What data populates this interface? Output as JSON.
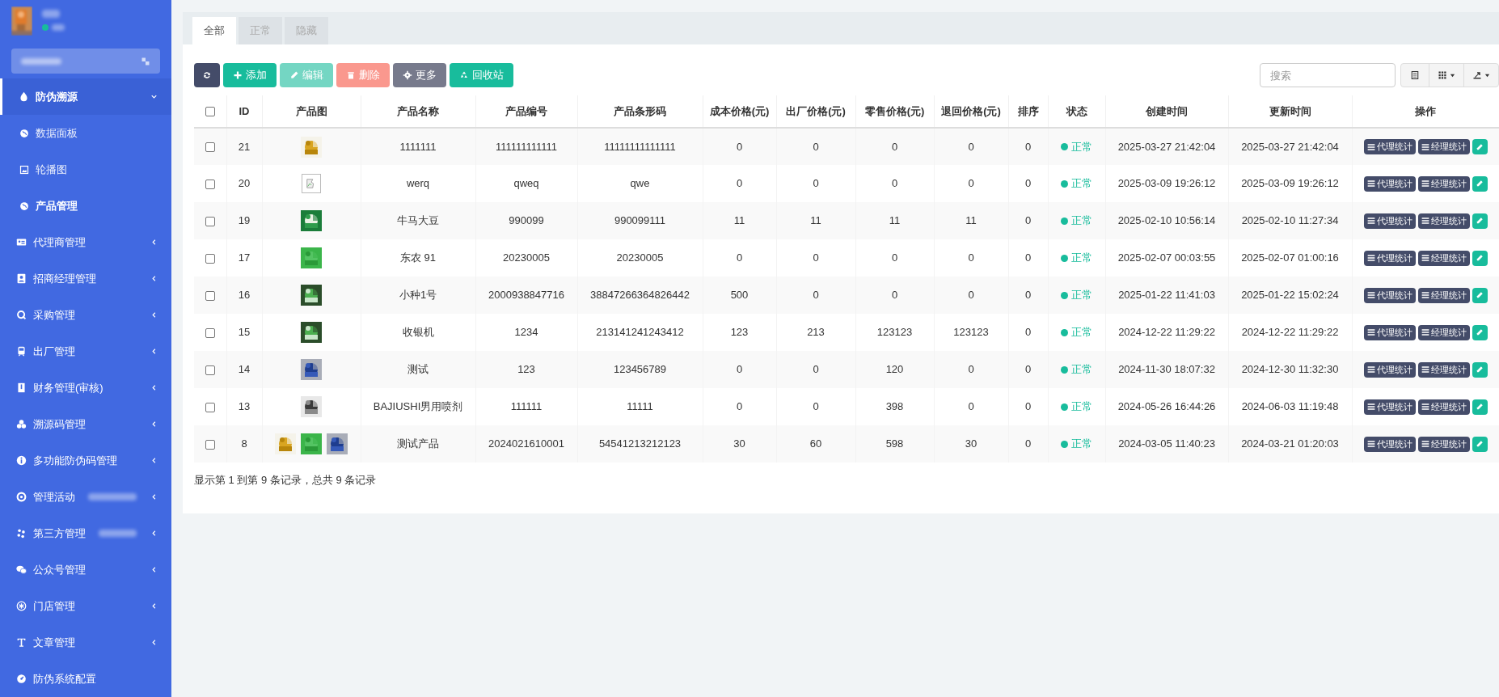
{
  "sidebar": {
    "avatar": {
      "kind": "picture"
    },
    "online": true,
    "menu": [
      {
        "kind": "group",
        "label": "防伪溯源",
        "expanded": true,
        "children": [
          {
            "label": "数据面板",
            "selected": false
          },
          {
            "label": "轮播图",
            "selected": false
          },
          {
            "label": "产品管理",
            "selected": true
          }
        ]
      },
      {
        "kind": "group",
        "label": "代理商管理",
        "expanded": false
      },
      {
        "kind": "group",
        "label": "招商经理管理",
        "expanded": false
      },
      {
        "kind": "group",
        "label": "采购管理",
        "expanded": false
      },
      {
        "kind": "group",
        "label": "出厂管理",
        "expanded": false
      },
      {
        "kind": "group",
        "label": "财务管理(审核)",
        "expanded": false
      },
      {
        "kind": "group",
        "label": "溯源码管理",
        "expanded": false
      },
      {
        "kind": "group",
        "label": "多功能防伪码管理",
        "expanded": false
      },
      {
        "kind": "group",
        "label": "管理活动",
        "expanded": false,
        "redacted_badge": true
      },
      {
        "kind": "group",
        "label": "第三方管理",
        "expanded": false,
        "redacted_badge": true
      },
      {
        "kind": "group",
        "label": "公众号管理",
        "expanded": false
      },
      {
        "kind": "group",
        "label": "门店管理",
        "expanded": false
      },
      {
        "kind": "group",
        "label": "文章管理",
        "expanded": false
      },
      {
        "kind": "link",
        "label": "防伪系统配置"
      }
    ]
  },
  "tabs": [
    {
      "label": "全部",
      "selected": true
    },
    {
      "label": "正常",
      "selected": false
    },
    {
      "label": "隐藏",
      "selected": false
    }
  ],
  "toolbar": [
    {
      "kind": "refresh",
      "disabled": false
    },
    {
      "kind": "add",
      "label": "添加",
      "disabled": false
    },
    {
      "kind": "edit",
      "label": "编辑",
      "disabled": true
    },
    {
      "kind": "delete",
      "label": "删除",
      "disabled": true
    },
    {
      "kind": "more",
      "label": "更多",
      "disabled": false
    },
    {
      "kind": "recycle",
      "label": "回收站",
      "disabled": false
    }
  ],
  "search": {
    "placeholder": "搜索"
  },
  "view_buttons": [
    {
      "kind": "toggle"
    },
    {
      "kind": "columns"
    },
    {
      "kind": "export"
    }
  ],
  "table": {
    "select_all": {
      "checked": false
    },
    "columns": [
      "ID",
      "产品图",
      "产品名称",
      "产品编号",
      "产品条形码",
      "成本价格(元)",
      "出厂价格(元)",
      "零售价格(元)",
      "退回价格(元)",
      "排序",
      "状态",
      "创建时间",
      "更新时间",
      "操作"
    ],
    "rows": [
      {
        "checked": false,
        "id": "21",
        "images": [
          {
            "kind": "picture"
          }
        ],
        "name": "1111111",
        "code": "111111111111",
        "barcode": "11111111111111",
        "cost": "0",
        "factory": "0",
        "retail": "0",
        "refund": "0",
        "sort": "0",
        "status": {
          "label": "正常",
          "color": "#18bc9c"
        },
        "created": "2025-03-27 21:42:04",
        "updated": "2025-03-27 21:42:04",
        "actions": [
          "代理统计",
          "经理统计"
        ]
      },
      {
        "checked": false,
        "id": "20",
        "images": [
          {
            "kind": "broken"
          }
        ],
        "name": "werq",
        "code": "qweq",
        "barcode": "qwe",
        "cost": "0",
        "factory": "0",
        "retail": "0",
        "refund": "0",
        "sort": "0",
        "status": {
          "label": "正常",
          "color": "#18bc9c"
        },
        "created": "2025-03-09 19:26:12",
        "updated": "2025-03-09 19:26:12",
        "actions": [
          "代理统计",
          "经理统计"
        ]
      },
      {
        "checked": false,
        "id": "19",
        "images": [
          {
            "kind": "picture"
          }
        ],
        "name": "牛马大豆",
        "code": "990099",
        "barcode": "990099111",
        "cost": "11",
        "factory": "11",
        "retail": "11",
        "refund": "11",
        "sort": "0",
        "status": {
          "label": "正常",
          "color": "#18bc9c"
        },
        "created": "2025-02-10 10:56:14",
        "updated": "2025-02-10 11:27:34",
        "actions": [
          "代理统计",
          "经理统计"
        ]
      },
      {
        "checked": false,
        "id": "17",
        "images": [
          {
            "kind": "picture"
          }
        ],
        "name": "东农 91",
        "code": "20230005",
        "barcode": "20230005",
        "cost": "0",
        "factory": "0",
        "retail": "0",
        "refund": "0",
        "sort": "0",
        "status": {
          "label": "正常",
          "color": "#18bc9c"
        },
        "created": "2025-02-07 00:03:55",
        "updated": "2025-02-07 01:00:16",
        "actions": [
          "代理统计",
          "经理统计"
        ]
      },
      {
        "checked": false,
        "id": "16",
        "images": [
          {
            "kind": "picture"
          }
        ],
        "name": "小种1号",
        "code": "2000938847716",
        "barcode": "38847266364826442",
        "cost": "500",
        "factory": "0",
        "retail": "0",
        "refund": "0",
        "sort": "0",
        "status": {
          "label": "正常",
          "color": "#18bc9c"
        },
        "created": "2025-01-22 11:41:03",
        "updated": "2025-01-22 15:02:24",
        "actions": [
          "代理统计",
          "经理统计"
        ]
      },
      {
        "checked": false,
        "id": "15",
        "images": [
          {
            "kind": "picture"
          }
        ],
        "name": "收银机",
        "code": "1234",
        "barcode": "213141241243412",
        "cost": "123",
        "factory": "213",
        "retail": "123123",
        "refund": "123123",
        "sort": "0",
        "status": {
          "label": "正常",
          "color": "#18bc9c"
        },
        "created": "2024-12-22 11:29:22",
        "updated": "2024-12-22 11:29:22",
        "actions": [
          "代理统计",
          "经理统计"
        ]
      },
      {
        "checked": false,
        "id": "14",
        "images": [
          {
            "kind": "picture"
          }
        ],
        "name": "测试",
        "code": "123",
        "barcode": "123456789",
        "cost": "0",
        "factory": "0",
        "retail": "120",
        "refund": "0",
        "sort": "0",
        "status": {
          "label": "正常",
          "color": "#18bc9c"
        },
        "created": "2024-11-30 18:07:32",
        "updated": "2024-12-30 11:32:30",
        "actions": [
          "代理统计",
          "经理统计"
        ]
      },
      {
        "checked": false,
        "id": "13",
        "images": [
          {
            "kind": "picture"
          }
        ],
        "name": "BAJIUSHI男用喷剂",
        "code": "111111",
        "barcode": "11111",
        "cost": "0",
        "factory": "0",
        "retail": "398",
        "refund": "0",
        "sort": "0",
        "status": {
          "label": "正常",
          "color": "#18bc9c"
        },
        "created": "2024-05-26 16:44:26",
        "updated": "2024-06-03 11:19:48",
        "actions": [
          "代理统计",
          "经理统计"
        ]
      },
      {
        "checked": false,
        "id": "8",
        "images": [
          {
            "kind": "picture"
          },
          {
            "kind": "picture"
          },
          {
            "kind": "picture"
          }
        ],
        "name": "测试产品",
        "code": "2024021610001",
        "barcode": "54541213212123",
        "cost": "30",
        "factory": "60",
        "retail": "598",
        "refund": "30",
        "sort": "0",
        "status": {
          "label": "正常",
          "color": "#18bc9c"
        },
        "created": "2024-03-05 11:40:23",
        "updated": "2024-03-21 01:20:03",
        "actions": [
          "代理统计",
          "经理统计"
        ]
      }
    ]
  },
  "footer": "显示第 1 到第 9 条记录，总共 9 条记录"
}
